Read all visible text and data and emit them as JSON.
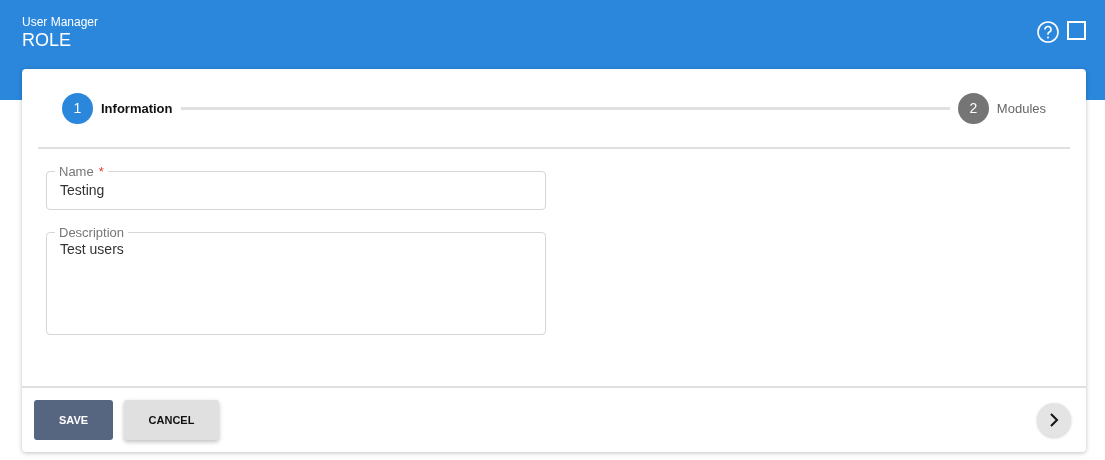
{
  "header": {
    "subtitle": "User Manager",
    "title": "ROLE"
  },
  "steps": [
    {
      "number": "1",
      "label": "Information",
      "selected": true
    },
    {
      "number": "2",
      "label": "Modules",
      "selected": false
    }
  ],
  "fields": [
    {
      "kind": "text",
      "label": "Name",
      "required_mark": "*",
      "value": "Testing"
    },
    {
      "kind": "textarea",
      "label": "Description",
      "value": "Test users"
    }
  ],
  "buttons": [
    {
      "kind": "primary",
      "label": "SAVE"
    },
    {
      "kind": "secondary",
      "label": "CANCEL"
    }
  ]
}
